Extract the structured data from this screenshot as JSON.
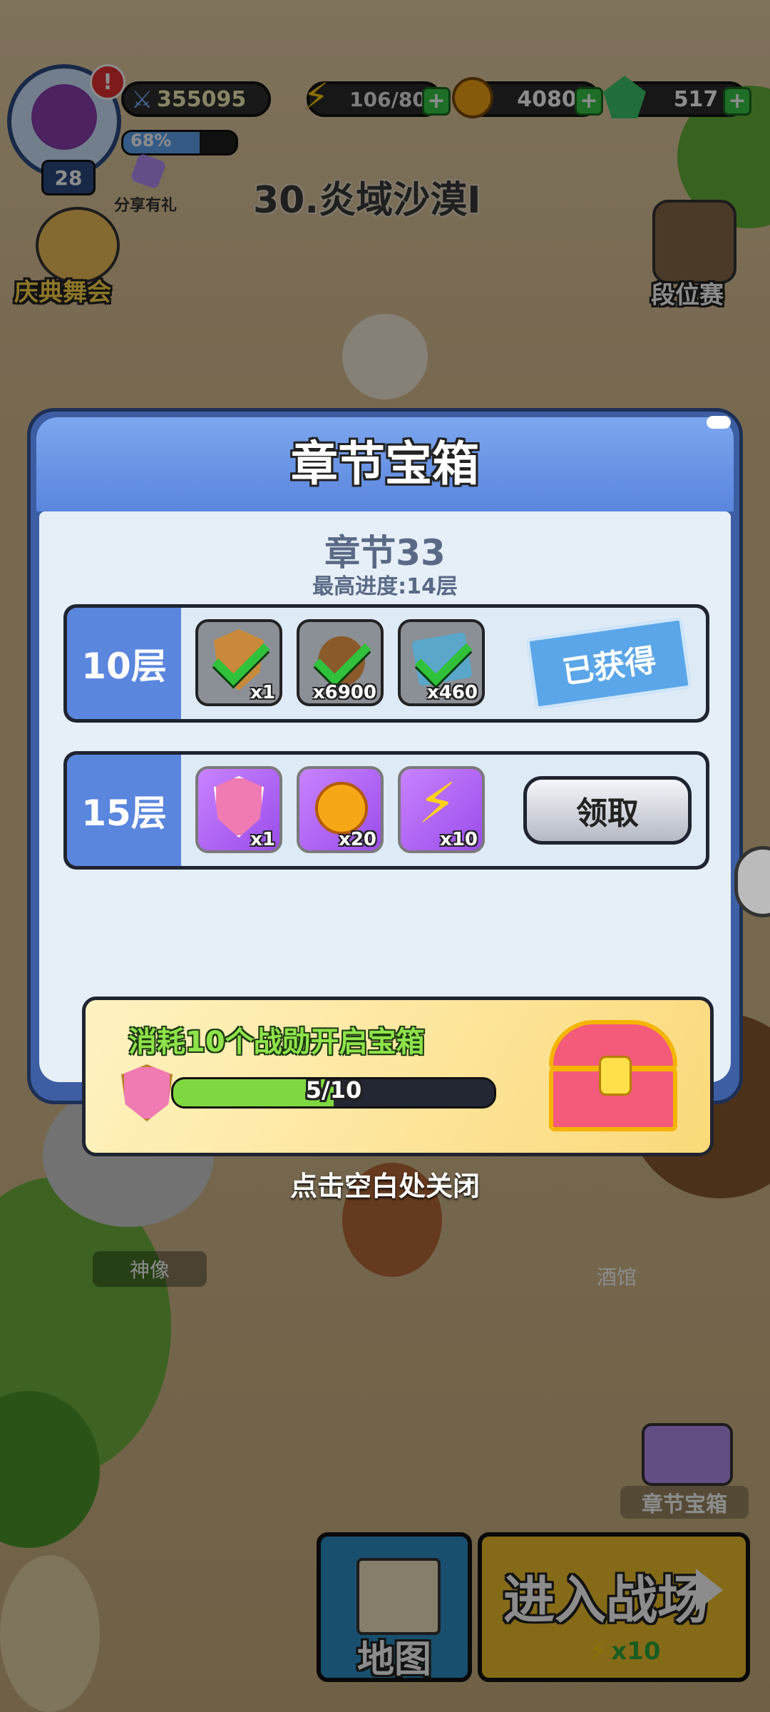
{
  "hud": {
    "level": "28",
    "exp_percent": "68%",
    "exp_fraction": 0.68,
    "power": "355095",
    "energy": "106/80",
    "coins": "4080",
    "gems": "517",
    "share_label": "分享有礼"
  },
  "map": {
    "stage_title": "30.炎域沙漠I",
    "festival_label": "庆典舞会",
    "ranked_label": "段位赛",
    "statue_label": "神像",
    "tavern_label": "酒馆",
    "chest_label": "章节宝箱",
    "map_button": "地图",
    "enter_button": "进入战场",
    "enter_cost": "x10"
  },
  "modal": {
    "title": "章节宝箱",
    "chapter": "章节33",
    "progress": "最高进度:14层",
    "rows": [
      {
        "floor": "10层",
        "items": [
          {
            "icon": "medal-shield-icon",
            "qty": "x1",
            "claimed": true
          },
          {
            "icon": "coin-bag-icon",
            "qty": "x6900",
            "claimed": true
          },
          {
            "icon": "book-icon",
            "qty": "x460",
            "claimed": true
          }
        ],
        "status": "已获得"
      },
      {
        "floor": "15层",
        "items": [
          {
            "icon": "medal-shield-icon",
            "qty": "x1",
            "claimed": false
          },
          {
            "icon": "gold-coin-icon",
            "qty": "x20",
            "claimed": false
          },
          {
            "icon": "lightning-icon",
            "qty": "x10",
            "claimed": false
          }
        ],
        "button": "领取"
      }
    ],
    "chest": {
      "description": "消耗10个战勋开启宝箱",
      "progress_text": "5/10",
      "progress_fraction": 0.5
    }
  },
  "close_hint": "点击空白处关闭",
  "colors": {
    "header_blue": "#5a86de",
    "panel_bg": "#e6eef7",
    "progress_green": "#7fd840",
    "energy_green": "#39c94a"
  }
}
